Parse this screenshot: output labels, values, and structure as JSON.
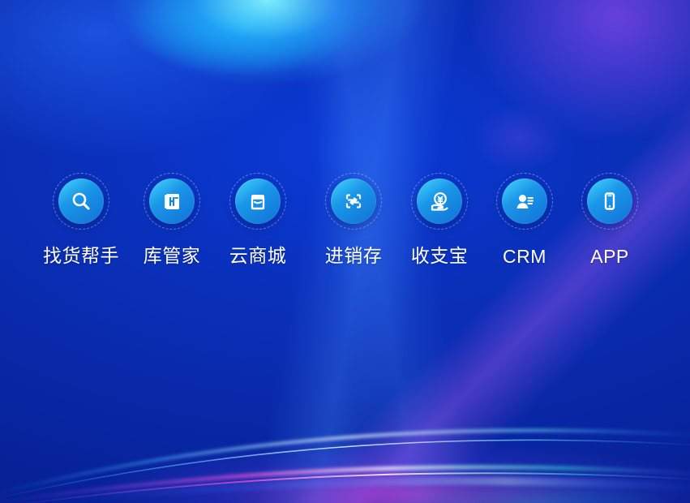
{
  "apps": [
    {
      "label": "找货帮手",
      "icon": "search-icon"
    },
    {
      "label": "库管家",
      "icon": "notebook-icon"
    },
    {
      "label": "云商城",
      "icon": "store-icon"
    },
    {
      "label": "进销存",
      "icon": "transfer-icon"
    },
    {
      "label": "收支宝",
      "icon": "coin-hand-icon"
    },
    {
      "label": "CRM",
      "icon": "contact-card-icon"
    },
    {
      "label": "APP",
      "icon": "mobile-phone-icon"
    }
  ],
  "colors": {
    "background_main": "#0a2fb8",
    "icon_disc_start": "#46d7ff",
    "icon_disc_end": "#1170d7",
    "label_text": "#ffffff"
  }
}
